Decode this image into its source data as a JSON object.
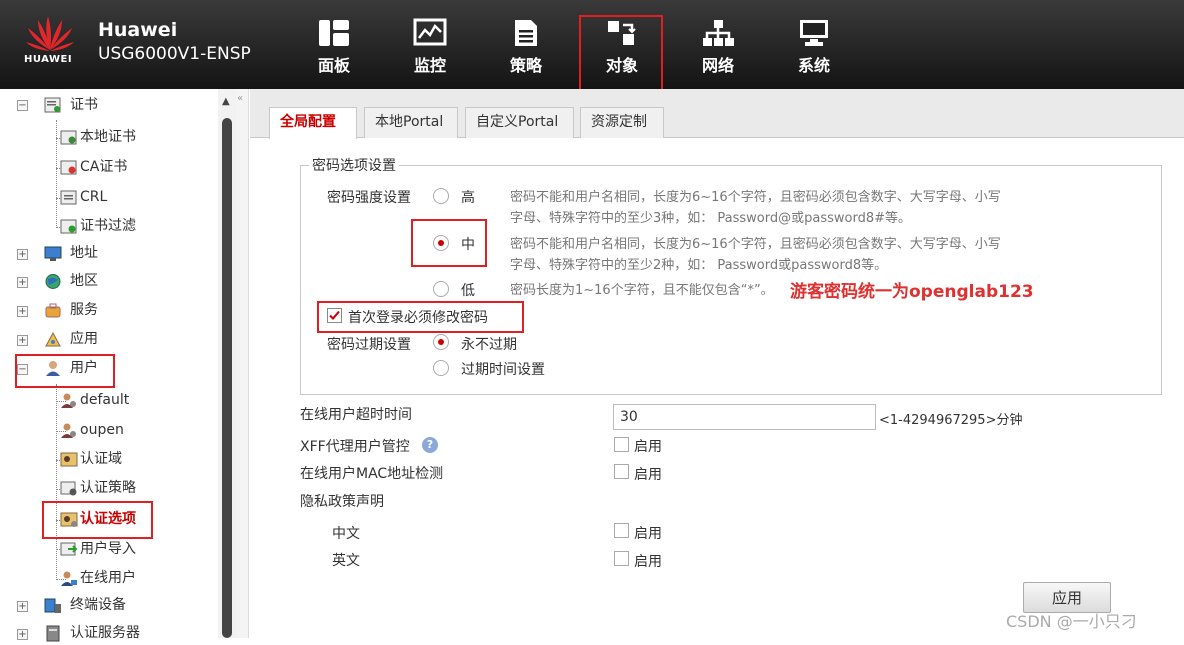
{
  "header": {
    "brand": "Huawei",
    "model": "USG6000V1-ENSP",
    "logo_text": "HUAWEI",
    "nav": [
      {
        "label": "面板",
        "icon": "dashboard-icon"
      },
      {
        "label": "监控",
        "icon": "monitor-icon"
      },
      {
        "label": "策略",
        "icon": "policy-icon"
      },
      {
        "label": "对象",
        "icon": "object-icon"
      },
      {
        "label": "网络",
        "icon": "network-icon"
      },
      {
        "label": "系统",
        "icon": "system-icon"
      }
    ]
  },
  "sidebar": {
    "items": [
      {
        "label": "证书",
        "toggle": "−"
      },
      {
        "label": "本地证书"
      },
      {
        "label": "CA证书"
      },
      {
        "label": "CRL"
      },
      {
        "label": "证书过滤"
      },
      {
        "label": "地址",
        "toggle": "+"
      },
      {
        "label": "地区",
        "toggle": "+"
      },
      {
        "label": "服务",
        "toggle": "+"
      },
      {
        "label": "应用",
        "toggle": "+"
      },
      {
        "label": "用户",
        "toggle": "−"
      },
      {
        "label": "default"
      },
      {
        "label": "oupen"
      },
      {
        "label": "认证域"
      },
      {
        "label": "认证策略"
      },
      {
        "label": "认证选项"
      },
      {
        "label": "用户导入"
      },
      {
        "label": "在线用户"
      },
      {
        "label": "终端设备",
        "toggle": "+"
      },
      {
        "label": "认证服务器",
        "toggle": "+"
      }
    ]
  },
  "tabs": [
    "全局配置",
    "本地Portal",
    "自定义Portal",
    "资源定制"
  ],
  "password_section": {
    "legend": "密码选项设置",
    "strength_label": "密码强度设置",
    "levels": [
      {
        "label": "高",
        "selected": false,
        "desc1": "密码不能和用户名相同，长度为6~16个字符，且密码必须包含数字、大写字母、小写",
        "desc2": "字母、特殊字符中的至少3种，如： Password@或password8#等。"
      },
      {
        "label": "中",
        "selected": true,
        "desc1": "密码不能和用户名相同，长度为6~16个字符，且密码必须包含数字、大写字母、小写",
        "desc2": "字母、特殊字符中的至少2种，如： Password或password8等。"
      },
      {
        "label": "低",
        "selected": false,
        "desc1": "密码长度为1~16个字符，且不能仅包含“*”。",
        "desc2": ""
      }
    ],
    "note": "游客密码统一为openglab123",
    "force_change_label": "首次登录必须修改密码",
    "force_change_checked": true,
    "expire_label": "密码过期设置",
    "expire_options": [
      {
        "label": "永不过期",
        "selected": true
      },
      {
        "label": "过期时间设置",
        "selected": false
      }
    ]
  },
  "settings": {
    "timeout_label": "在线用户超时时间",
    "timeout_value": "30",
    "timeout_hint": "<1-4294967295>分钟",
    "xff_label": "XFF代理用户管控",
    "mac_label": "在线用户MAC地址检测",
    "privacy_label": "隐私政策声明",
    "chinese_label": "中文",
    "english_label": "英文",
    "enable_label": "启用",
    "apply_label": "应用"
  },
  "watermark": "CSDN @一小只刁",
  "colors": {
    "accent": "#cc0000",
    "annotation": "#e02020"
  }
}
